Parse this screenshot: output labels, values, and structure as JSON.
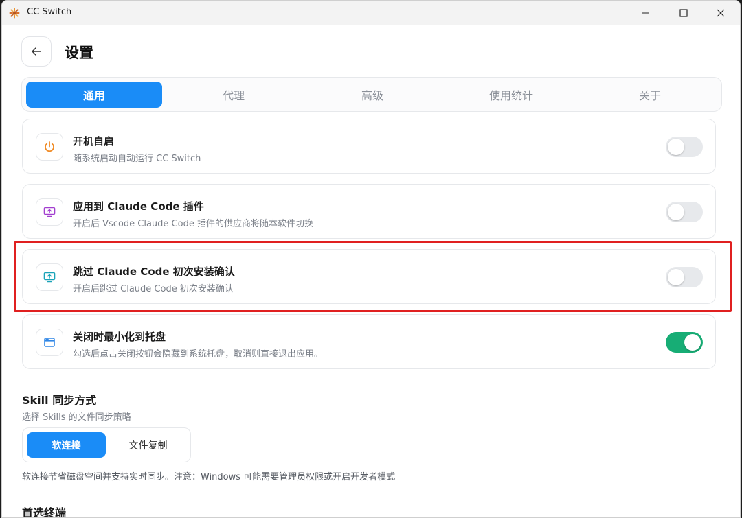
{
  "window": {
    "title": "CC Switch"
  },
  "header": {
    "title": "设置"
  },
  "tabs": [
    {
      "label": "通用",
      "active": true
    },
    {
      "label": "代理",
      "active": false
    },
    {
      "label": "高级",
      "active": false
    },
    {
      "label": "使用统计",
      "active": false
    },
    {
      "label": "关于",
      "active": false
    }
  ],
  "settings": [
    {
      "icon": "power-icon",
      "title": "开机自启",
      "desc": "随系统启动自动运行 CC Switch",
      "enabled": false
    },
    {
      "icon": "monitor-upload-icon",
      "title": "应用到 Claude Code 插件",
      "desc": "开启后 Vscode Claude Code 插件的供应商将随本软件切换",
      "enabled": false
    },
    {
      "icon": "monitor-upload-icon",
      "title": "跳过 Claude Code 初次安装确认",
      "desc": "开启后跳过 Claude Code 初次安装确认",
      "enabled": false
    },
    {
      "icon": "window-tray-icon",
      "title": "关闭时最小化到托盘",
      "desc": "勾选后点击关闭按钮会隐藏到系统托盘，取消则直接退出应用。",
      "enabled": true
    }
  ],
  "skill_sync": {
    "title": "Skill 同步方式",
    "desc": "选择 Skills 的文件同步策略",
    "options": [
      {
        "label": "软连接",
        "active": true
      },
      {
        "label": "文件复制",
        "active": false
      }
    ],
    "note": "软连接节省磁盘空间并支持实时同步。注意：Windows 可能需要管理员权限或开启开发者模式"
  },
  "terminal": {
    "title": "首选终端"
  },
  "colors": {
    "accent": "#1a8cf7",
    "toggle_on": "#17ad75",
    "highlight": "#e02020"
  }
}
